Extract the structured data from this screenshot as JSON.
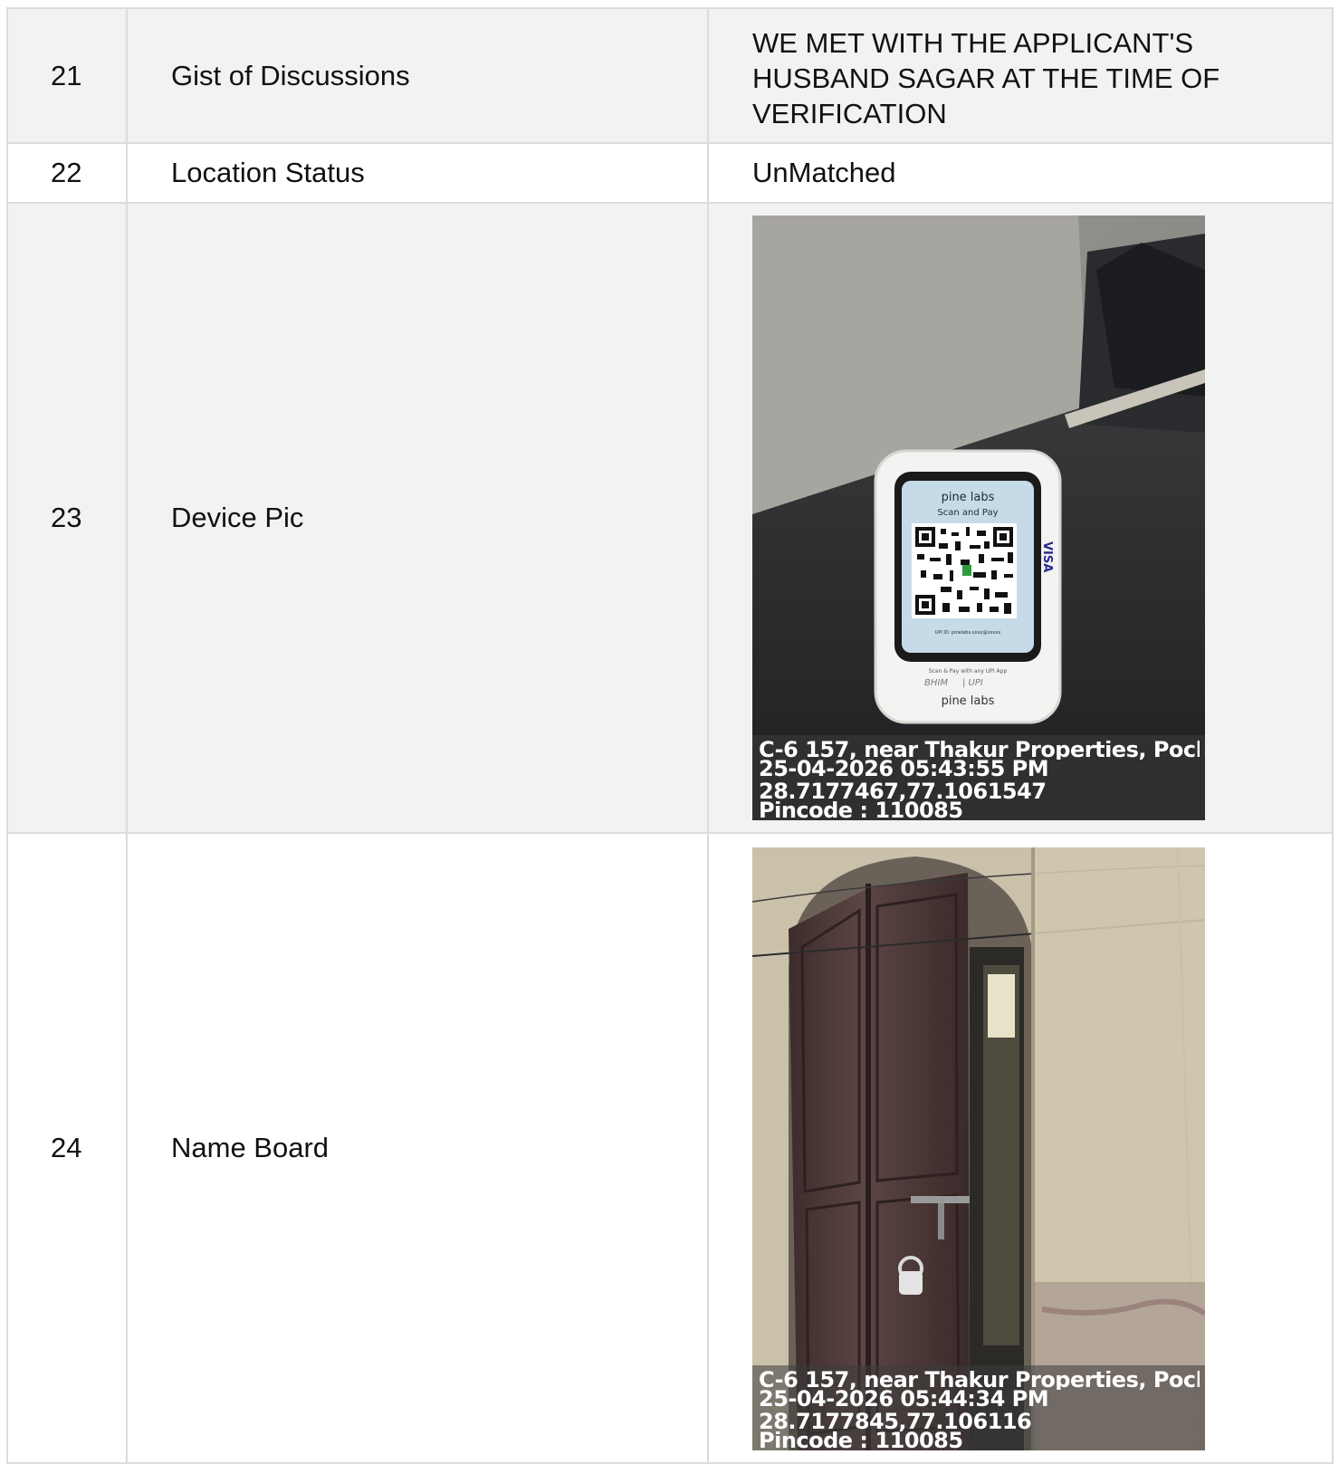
{
  "rows": [
    {
      "num": "21",
      "label": "Gist of Discussions",
      "value": "WE MET WITH THE APPLICANT'S HUSBAND SAGAR AT THE TIME OF VERIFICATION"
    },
    {
      "num": "22",
      "label": "Location Status",
      "value": "UnMatched"
    },
    {
      "num": "23",
      "label": "Device Pic",
      "photo": {
        "address": "C-6 157, near Thakur Properties, Pocket ...",
        "datetime": "25-04-2026 05:43:55 PM",
        "coords": "28.7177467,77.1061547",
        "pincode": "Pincode : 110085",
        "device_brand": "pine labs",
        "screen_text": "Scan and Pay",
        "footer_text": "Scan & Pay with any UPI App",
        "card_logo": "VISA"
      }
    },
    {
      "num": "24",
      "label": "Name Board",
      "photo": {
        "address": "C-6 157, near Thakur Properties, Pocket ...",
        "datetime": "25-04-2026 05:44:34 PM",
        "coords": "28.7177845,77.106116",
        "pincode": "Pincode : 110085"
      }
    }
  ]
}
